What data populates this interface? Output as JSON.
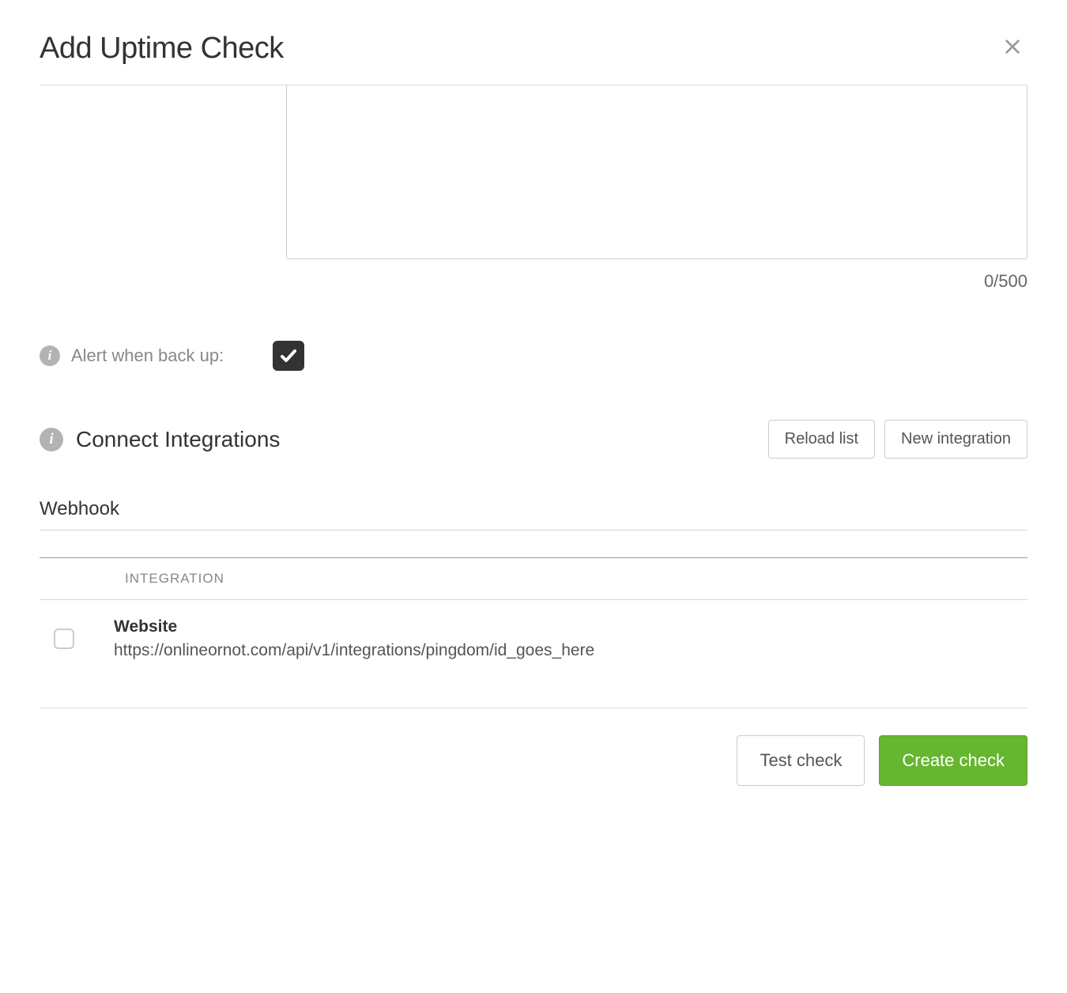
{
  "modal": {
    "title": "Add Uptime Check",
    "char_counter": "0/500",
    "alert_back_up": {
      "label": "Alert when back up:",
      "checked": true
    },
    "integrations": {
      "section_title": "Connect Integrations",
      "reload_label": "Reload list",
      "new_label": "New integration",
      "webhook_heading": "Webhook",
      "column_header": "INTEGRATION",
      "items": [
        {
          "name": "Website",
          "url": "https://onlineornot.com/api/v1/integrations/pingdom/id_goes_here",
          "checked": false
        }
      ]
    },
    "footer": {
      "test_label": "Test check",
      "create_label": "Create check"
    }
  }
}
